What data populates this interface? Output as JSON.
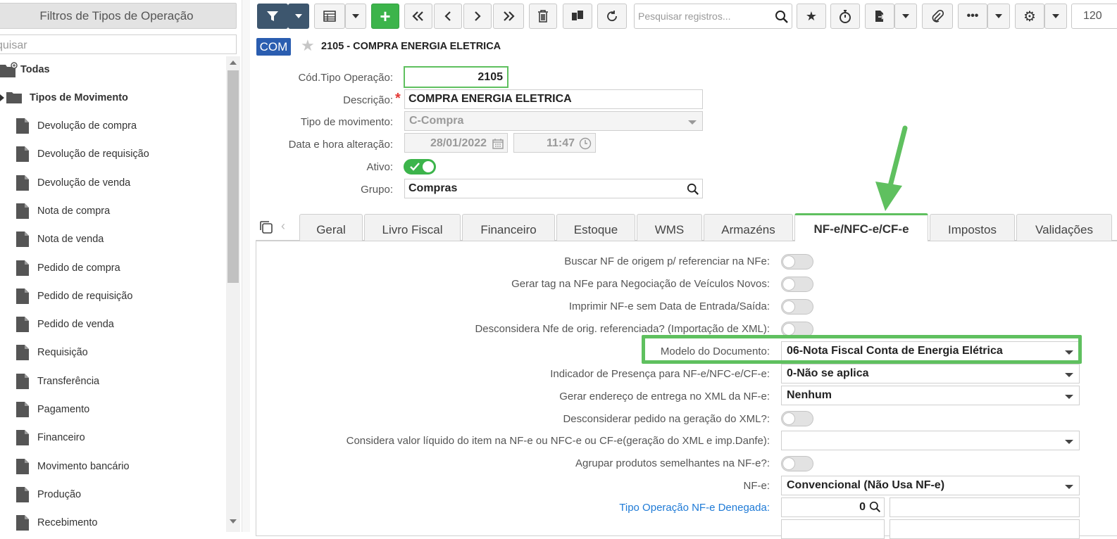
{
  "sidebar": {
    "title": "Filtros de Tipos de Operação",
    "search_placeholder": "quisar",
    "root_label": "Todas",
    "group_label": "Tipos de Movimento",
    "items": [
      "Devolução de compra",
      "Devolução de requisição",
      "Devolução de venda",
      "Nota de compra",
      "Nota de venda",
      "Pedido de compra",
      "Pedido de requisição",
      "Pedido de venda",
      "Requisição",
      "Transferência",
      "Pagamento",
      "Financeiro",
      "Movimento bancário",
      "Produção",
      "Recebimento"
    ]
  },
  "toolbar": {
    "search_placeholder": "Pesquisar registros...",
    "page_size": "120"
  },
  "record": {
    "badge": "COM",
    "title": "2105 - COMPRA ENERGIA ELETRICA"
  },
  "form": {
    "cod_label": "Cód.Tipo Operação:",
    "cod_value": "2105",
    "desc_label": "Descrição:",
    "desc_value": "COMPRA ENERGIA ELETRICA",
    "mov_label": "Tipo de movimento:",
    "mov_value": "C-Compra",
    "date_label": "Data e hora alteração:",
    "date_value": "28/01/2022",
    "time_value": "11:47",
    "ativo_label": "Ativo:",
    "ativo_on": true,
    "grupo_label": "Grupo:",
    "grupo_value": "Compras"
  },
  "tabs": [
    "Geral",
    "Livro Fiscal",
    "Financeiro",
    "Estoque",
    "WMS",
    "Armazéns",
    "NF-e/NFC-e/CF-e",
    "Impostos",
    "Validações"
  ],
  "active_tab": "NF-e/NFC-e/CF-e",
  "nfe": {
    "buscar_nf": "Buscar NF de origem p/ referenciar na NFe:",
    "gerar_tag": "Gerar tag na NFe para Negociação de Veículos Novos:",
    "imprimir": "Imprimir NF-e sem Data de Entrada/Saída:",
    "desconsidera_nfe": "Desconsidera Nfe de orig. referenciada? (Importação de XML):",
    "modelo_label": "Modelo do Documento:",
    "modelo_value": "06-Nota Fiscal Conta de Energia Elétrica",
    "presenca_label": "Indicador de Presença para NF-e/NFC-e/CF-e:",
    "presenca_value": "0-Não se aplica",
    "endereco_label": "Gerar endereço de entrega no XML da NF-e:",
    "endereco_value": "Nenhum",
    "desconsiderar_pedido": "Desconsiderar pedido na geração do XML?:",
    "valor_liquido_label": "Considera valor líquido do item na NF-e ou NFC-e ou CF-e(geração do XML e imp.Danfe):",
    "valor_liquido_value": "",
    "agrupar": "Agrupar produtos semelhantes na NF-e?:",
    "nfe_label": "NF-e:",
    "nfe_value": "Convencional (Não Usa NF-e)",
    "denegada_label": "Tipo Operação NF-e Denegada:",
    "denegada_value": "0"
  },
  "colors": {
    "accent_green": "#5fc05f",
    "toolbar_dark": "#3d566e",
    "badge_blue": "#2a5db0",
    "link_blue": "#1e7ad6"
  }
}
